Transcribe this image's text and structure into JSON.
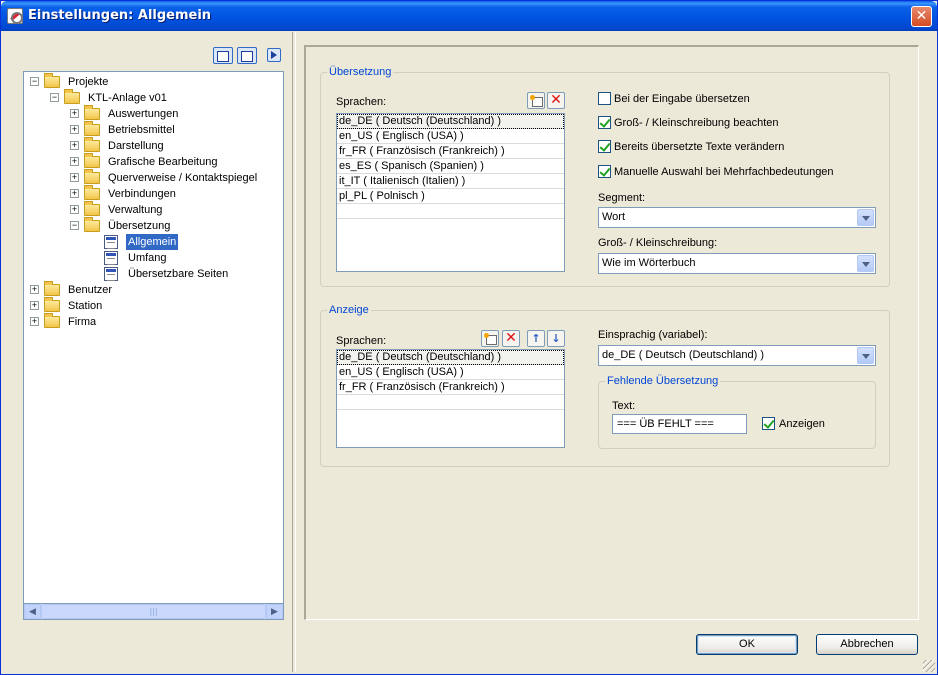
{
  "window": {
    "title": "Einstellungen: Allgemein",
    "close_glyph": "✕"
  },
  "tree": {
    "toolbar_icons": [
      "expand-all-icon",
      "collapse-all-icon",
      "go-icon"
    ],
    "nodes": [
      {
        "label": "Projekte",
        "expander": "−",
        "icon": "folder-icon"
      },
      {
        "label": "KTL-Anlage v01",
        "expander": "−",
        "icon": "folder-icon"
      },
      {
        "label": "Auswertungen",
        "expander": "+",
        "icon": "folder-icon"
      },
      {
        "label": "Betriebsmittel",
        "expander": "+",
        "icon": "folder-icon"
      },
      {
        "label": "Darstellung",
        "expander": "+",
        "icon": "folder-icon"
      },
      {
        "label": "Grafische Bearbeitung",
        "expander": "+",
        "icon": "folder-icon"
      },
      {
        "label": "Querverweise / Kontaktspiegel",
        "expander": "+",
        "icon": "folder-icon"
      },
      {
        "label": "Verbindungen",
        "expander": "+",
        "icon": "folder-icon"
      },
      {
        "label": "Verwaltung",
        "expander": "+",
        "icon": "folder-icon"
      },
      {
        "label": "Übersetzung",
        "expander": "−",
        "icon": "folder-icon"
      },
      {
        "label": "Allgemein",
        "expander": "",
        "icon": "settings-page-icon",
        "selected": true
      },
      {
        "label": "Umfang",
        "expander": "",
        "icon": "settings-page-icon"
      },
      {
        "label": "Übersetzbare Seiten",
        "expander": "",
        "icon": "settings-page-icon"
      },
      {
        "label": "Benutzer",
        "expander": "+",
        "icon": "folder-icon"
      },
      {
        "label": "Station",
        "expander": "+",
        "icon": "folder-icon"
      },
      {
        "label": "Firma",
        "expander": "+",
        "icon": "folder-icon"
      }
    ],
    "scroll_left": "◀",
    "scroll_right": "▶",
    "scroll_grip": "|||"
  },
  "uebersetzung": {
    "title": "Übersetzung",
    "languages_label": "Sprachen:",
    "languages": [
      "de_DE ( Deutsch (Deutschland) )",
      "en_US ( Englisch (USA) )",
      "fr_FR ( Französisch (Frankreich) )",
      "es_ES ( Spanisch (Spanien) )",
      "it_IT ( Italienisch (Italien) )",
      "pl_PL ( Polnisch )"
    ],
    "del_glyph": "✕",
    "checkboxes": [
      {
        "label": "Bei der Eingabe übersetzen",
        "checked": false
      },
      {
        "label": "Groß- / Kleinschreibung beachten",
        "checked": true
      },
      {
        "label": "Bereits übersetzte Texte verändern",
        "checked": true
      },
      {
        "label": "Manuelle Auswahl bei Mehrfachbedeutungen",
        "checked": true
      }
    ],
    "segment_label": "Segment:",
    "segment_value": "Wort",
    "case_label": "Groß- / Kleinschreibung:",
    "case_value": "Wie im Wörterbuch"
  },
  "anzeige": {
    "title": "Anzeige",
    "languages_label": "Sprachen:",
    "languages": [
      "de_DE ( Deutsch (Deutschland) )",
      "en_US ( Englisch (USA) )",
      "fr_FR ( Französisch (Frankreich) )"
    ],
    "del_glyph": "✕",
    "up_glyph": "↑",
    "down_glyph": "↓",
    "monolingual_label": "Einsprachig (variabel):",
    "monolingual_value": "de_DE ( Deutsch (Deutschland) )",
    "missing": {
      "title": "Fehlende Übersetzung",
      "text_label": "Text:",
      "text_value": "=== ÜB FEHLT ===",
      "show_label": "Anzeigen",
      "show_checked": true
    }
  },
  "buttons": {
    "ok": "OK",
    "cancel": "Abbrechen"
  },
  "colors": {
    "titlebar": "#0053e1",
    "selection": "#316ac5",
    "group_title": "#0046d5",
    "face": "#ece9d8"
  }
}
